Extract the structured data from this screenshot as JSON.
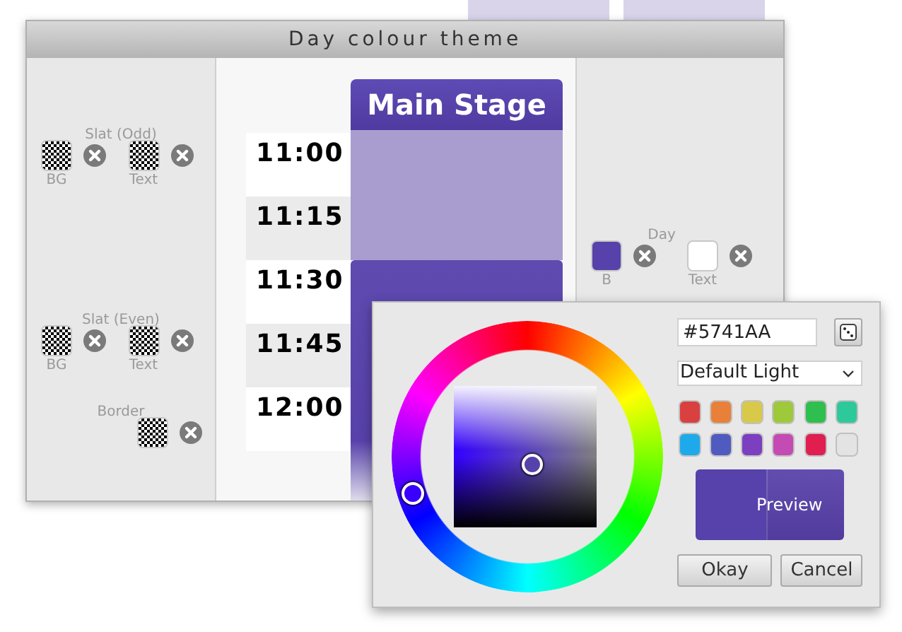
{
  "dialog": {
    "title": "Day colour theme",
    "left_groups": [
      {
        "label": "Slat (Odd)",
        "swatches": [
          {
            "label": "BG",
            "kind": "transparent"
          },
          {
            "label": "Text",
            "kind": "transparent"
          }
        ]
      },
      {
        "label": "Slat (Even)",
        "swatches": [
          {
            "label": "BG",
            "kind": "transparent"
          },
          {
            "label": "Text",
            "kind": "transparent"
          }
        ]
      },
      {
        "label": "Border",
        "swatches": [
          {
            "kind": "transparent"
          }
        ]
      }
    ],
    "times": [
      {
        "time": "11:00",
        "highlighted": true
      },
      {
        "time": "11:15",
        "highlighted": false
      },
      {
        "time": "11:30",
        "highlighted": true
      },
      {
        "time": "11:45",
        "highlighted": false
      },
      {
        "time": "12:00",
        "highlighted": true
      }
    ],
    "stage": {
      "title": "Main Stage"
    },
    "right_group": {
      "label": "Day",
      "swatches": [
        {
          "label": "B",
          "kind": "color",
          "color": "#5741aa"
        },
        {
          "label": "Text",
          "kind": "color",
          "color": "#ffffff"
        }
      ]
    }
  },
  "color_picker": {
    "hex": "#5741AA",
    "palette": "Default Light",
    "swatches": [
      {
        "color": "#d94040"
      },
      {
        "color": "#e8803a"
      },
      {
        "color": "#d9c94a"
      },
      {
        "color": "#9dc93a"
      },
      {
        "color": "#2ebf4e"
      },
      {
        "color": "#2ec99a"
      },
      {
        "color": "#1eaaea"
      },
      {
        "color": "#4f5bbf"
      },
      {
        "color": "#7b3fbf"
      },
      {
        "color": "#c44ab4"
      },
      {
        "color": "#e01e50"
      },
      {
        "color": "#e3e3e3"
      }
    ],
    "preview": "Preview",
    "buttons": [
      "Okay",
      "Cancel"
    ]
  }
}
